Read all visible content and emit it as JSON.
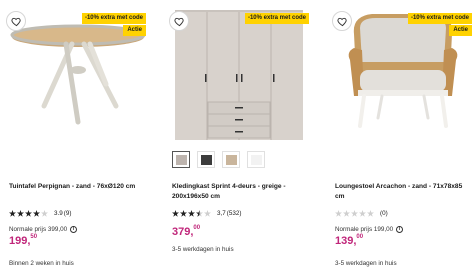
{
  "products": [
    {
      "title": "Tuintafel Perpignan - zand - 76xØ120 cm",
      "badge_extra": "-10% extra met code",
      "badge_actie": "Actie",
      "rating_value": "3.9",
      "rating_count": "(9)",
      "stars_filled": 4,
      "normal_price": "Normale prijs 399,00",
      "price_main": "199,",
      "price_cents": "50",
      "delivery": "Binnen 2 weken in huis",
      "icon": "round-table-image"
    },
    {
      "title": "Kledingkast Sprint 4-deurs - greige - 200x196x50 cm",
      "badge_extra": "-10% extra met code",
      "rating_value": "3,7",
      "rating_count": "(532)",
      "stars_filled": 3.5,
      "price_main": "379,",
      "price_cents": "00",
      "delivery": "3-5 werkdagen in huis",
      "swatch_colors": [
        "#bdb4ae",
        "#3c3c3c",
        "#c9b59c",
        "#f2f2f2"
      ],
      "icon": "wardrobe-image"
    },
    {
      "title": "Loungestoel Arcachon - zand - 71x78x85 cm",
      "badge_extra": "-10% extra met code",
      "badge_actie": "Actie",
      "rating_count": "(0)",
      "stars_filled": 0,
      "normal_price": "Normale prijs 199,00",
      "price_main": "139,",
      "price_cents": "00",
      "delivery": "3-5 werkdagen in huis",
      "icon": "lounge-chair-image"
    }
  ],
  "colors": {
    "badge": "#ffd200",
    "price": "#c0267a"
  }
}
